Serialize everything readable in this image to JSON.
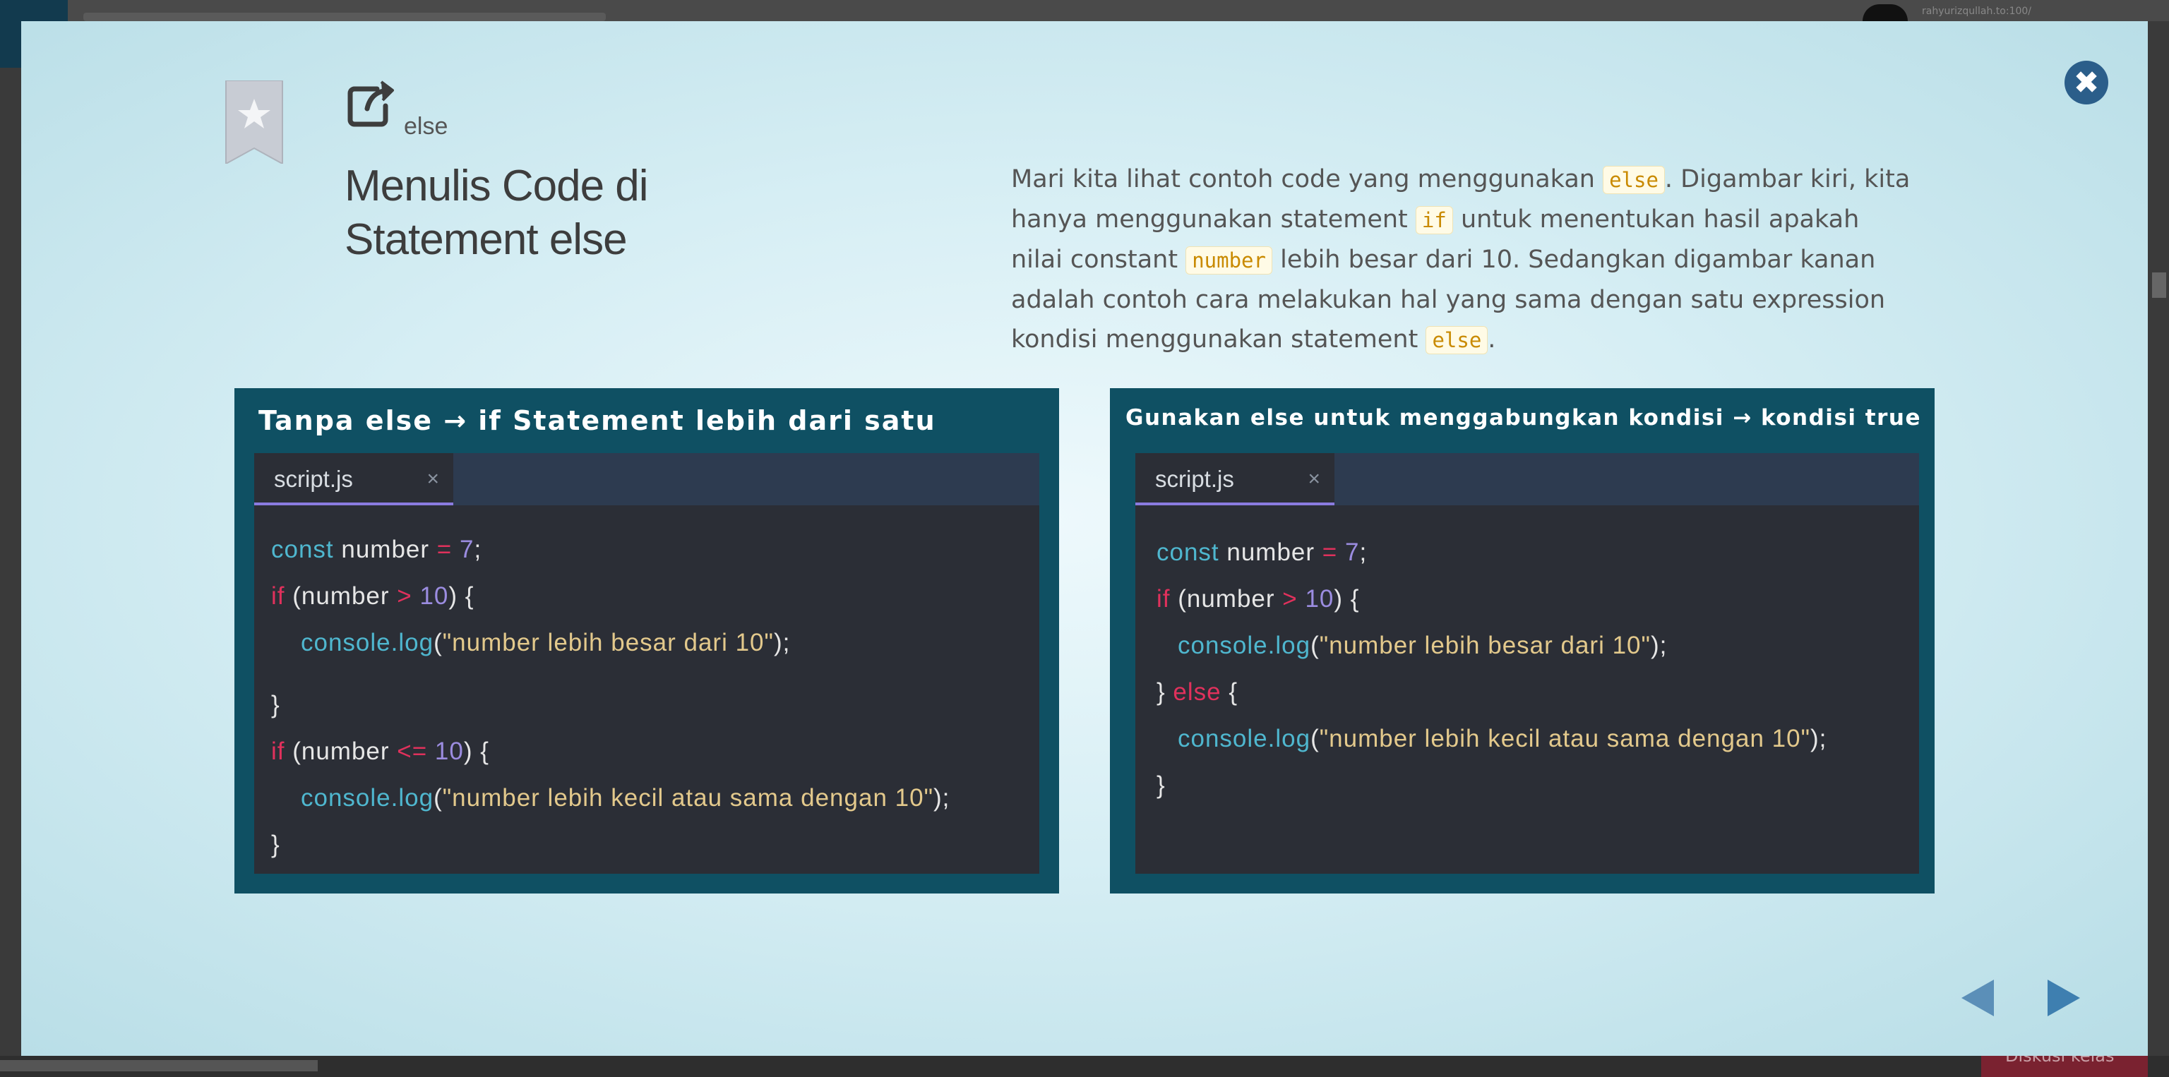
{
  "background": {
    "username": "rahyurizqullah.to:100/",
    "discussion_label": "Diskusi kelas"
  },
  "modal": {
    "breadcrumb": "else",
    "title_line1": "Menulis Code di",
    "title_line2": "Statement else",
    "description": {
      "p1": "Mari kita lihat contoh code yang menggunakan ",
      "c1": "else",
      "p2": ". Digambar kiri, kita hanya menggunakan statement ",
      "c2": "if",
      "p3": " untuk menentukan hasil apakah nilai constant ",
      "c3": "number",
      "p4": " lebih besar dari 10. Sedangkan digambar kanan adalah contoh cara melakukan hal yang sama dengan satu expression kondisi menggunakan statement ",
      "c4": "else",
      "p5": "."
    },
    "left_panel": {
      "title": "Tanpa else → if Statement lebih dari satu",
      "tab": "script.js",
      "tab_close": "×",
      "code": {
        "const_kw": "const",
        "var": " number ",
        "eq": "=",
        "seven": " 7",
        "semi": ";",
        "if_kw": "if",
        "open": " (number ",
        "gt": ">",
        "ten": " 10",
        "close_brace_open": ") {",
        "console": "console.log",
        "str1": "\"number lebih besar dari 10\"",
        "paren_open": "(",
        "paren_close_semi": ");",
        "brace_close": "}",
        "lte": "<=",
        "str2": "\"number lebih kecil atau sama dengan 10\""
      }
    },
    "right_panel": {
      "title": "Gunakan else untuk menggabungkan kondisi → kondisi true",
      "tab": "script.js",
      "tab_close": "×",
      "code": {
        "else_prefix": "} ",
        "else_kw": "else",
        "else_suffix": " {"
      }
    }
  }
}
